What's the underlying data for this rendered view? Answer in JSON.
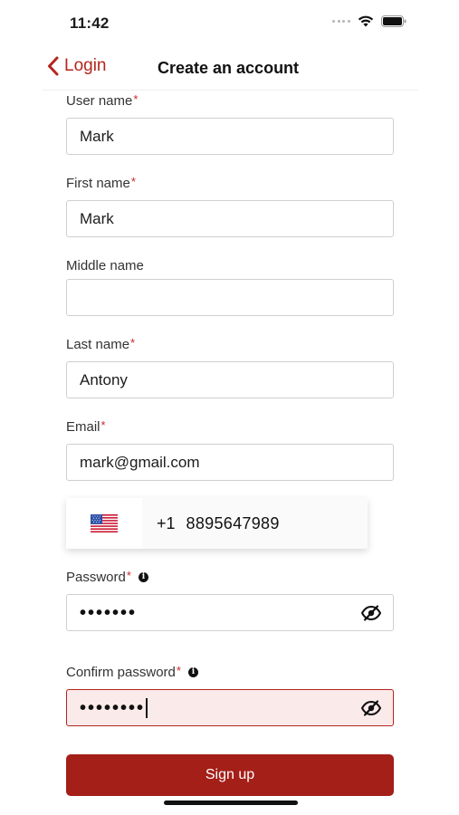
{
  "status_bar": {
    "time": "11:42"
  },
  "nav": {
    "back_label": "Login",
    "title": "Create an account"
  },
  "form": {
    "required_mark": "*",
    "info_mark": "i",
    "username": {
      "label": "User name",
      "value": "Mark"
    },
    "first_name": {
      "label": "First name",
      "value": "Mark"
    },
    "middle_name": {
      "label": "Middle name",
      "value": ""
    },
    "last_name": {
      "label": "Last name",
      "value": "Antony"
    },
    "email": {
      "label": "Email",
      "value": "mark@gmail.com"
    },
    "phone": {
      "country_flag": "us-flag-icon",
      "dial_code": "+1",
      "number": "8895647989"
    },
    "password": {
      "label": "Password",
      "masked": "•••••••"
    },
    "confirm_password": {
      "label": "Confirm password",
      "masked": "••••••••",
      "state": "error"
    }
  },
  "signup_label": "Sign up",
  "colors": {
    "accent": "#a31f18",
    "error_bg": "#fbeaea",
    "required": "#c62828"
  }
}
